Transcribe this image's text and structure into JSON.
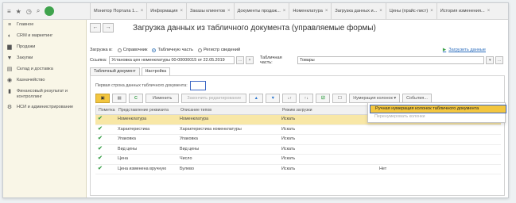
{
  "topbar": {
    "tabs": [
      {
        "label": "Монитор Портала 1..."
      },
      {
        "label": "Информация"
      },
      {
        "label": "Заказы клиентов"
      },
      {
        "label": "Документы продаж..."
      },
      {
        "label": "Номенклатура"
      },
      {
        "label": "Загрузка данных и..."
      },
      {
        "label": "Цены (прайс-лист)"
      },
      {
        "label": "История изменения..."
      }
    ],
    "close_glyph": "×"
  },
  "sidebar": {
    "items": [
      {
        "label": "Главное",
        "icon": "menu-icon",
        "glyph": "≡"
      },
      {
        "label": "CRM и маркетинг",
        "icon": "crm-icon",
        "glyph": "◐"
      },
      {
        "label": "Продажи",
        "icon": "sales-icon",
        "glyph": "▆"
      },
      {
        "label": "Закупки",
        "icon": "purchases-icon",
        "glyph": "▼"
      },
      {
        "label": "Склад и доставка",
        "icon": "warehouse-icon",
        "glyph": "▤"
      },
      {
        "label": "Казначейство",
        "icon": "treasury-icon",
        "glyph": "◉"
      },
      {
        "label": "Финансовый результат и контроллинг",
        "icon": "finance-icon",
        "glyph": "▮"
      },
      {
        "label": "НСИ и администрирование",
        "icon": "settings-icon",
        "glyph": "⚙"
      }
    ]
  },
  "header": {
    "back": "←",
    "forward": "→",
    "title": "Загрузка данных из табличного документа (управляемые формы)"
  },
  "load_to": {
    "label": "Загрузка в:",
    "options": [
      "Справочник",
      "Табличную часть",
      "Регистр сведений"
    ],
    "selected": "Табличную часть",
    "link_arrow": "▶",
    "link": "Загрузить данные"
  },
  "reference": {
    "label": "Ссылка:",
    "value": "Установка цен номенклатуры 00-00000015 от 22.05.2019",
    "pick": "...",
    "clear": "×",
    "tabpart_label": "Табличная часть:",
    "tabpart_value": "Товары",
    "tabpart_pick": "▾",
    "tabpart_clear": "..."
  },
  "subtabs": [
    "Табличный документ",
    "Настройка"
  ],
  "settings": {
    "first_row_label": "Первая строка данных табличного документа:",
    "first_row_value": ""
  },
  "toolbar": {
    "btn_save": "▣",
    "btn_open": "▤",
    "btn_refresh": "C",
    "btn_change": "Изменить",
    "btn_finish": "Закончить редактирование",
    "btn_up": "▲",
    "btn_down": "▼",
    "btn_sort_asc": "↓↑",
    "btn_sort_desc": "↑↓",
    "btn_check": "☑",
    "btn_uncheck": "☐",
    "numbering_button": "Нумерация колонок",
    "numbering_arrow": "▾",
    "events_button": "События..."
  },
  "numbering_menu": {
    "item_manual": "Ручная нумерация колонок табличного документа",
    "item_renumber": "Перенумеровать колонки"
  },
  "table": {
    "headers": [
      "Пометка",
      "Представление реквизита",
      "Описание типов",
      "Режим загрузки",
      ""
    ],
    "rows": [
      {
        "checked": "✔",
        "name": "Номенклатура",
        "type": "Номенклатура",
        "mode": "Искать",
        "extra": ""
      },
      {
        "checked": "✔",
        "name": "Характеристика",
        "type": "Характеристика номенклатуры",
        "mode": "Искать",
        "extra": ""
      },
      {
        "checked": "✔",
        "name": "Упаковка",
        "type": "Упаковка",
        "mode": "Искать",
        "extra": ""
      },
      {
        "checked": "✔",
        "name": "Вид цены",
        "type": "Вид цены",
        "mode": "Искать",
        "extra": ""
      },
      {
        "checked": "✔",
        "name": "Цена",
        "type": "Число",
        "mode": "Искать",
        "extra": ""
      },
      {
        "checked": "✔",
        "name": "Цена изменена вручную",
        "type": "Булево",
        "mode": "Искать",
        "extra": "Нет"
      }
    ],
    "selected_row": 0
  },
  "colors": {
    "accent_yellow": "#f3c63f",
    "focus_blue": "#3b66c4",
    "check_green": "#3aa04a",
    "sidebar_bg": "#f9f6e7"
  }
}
